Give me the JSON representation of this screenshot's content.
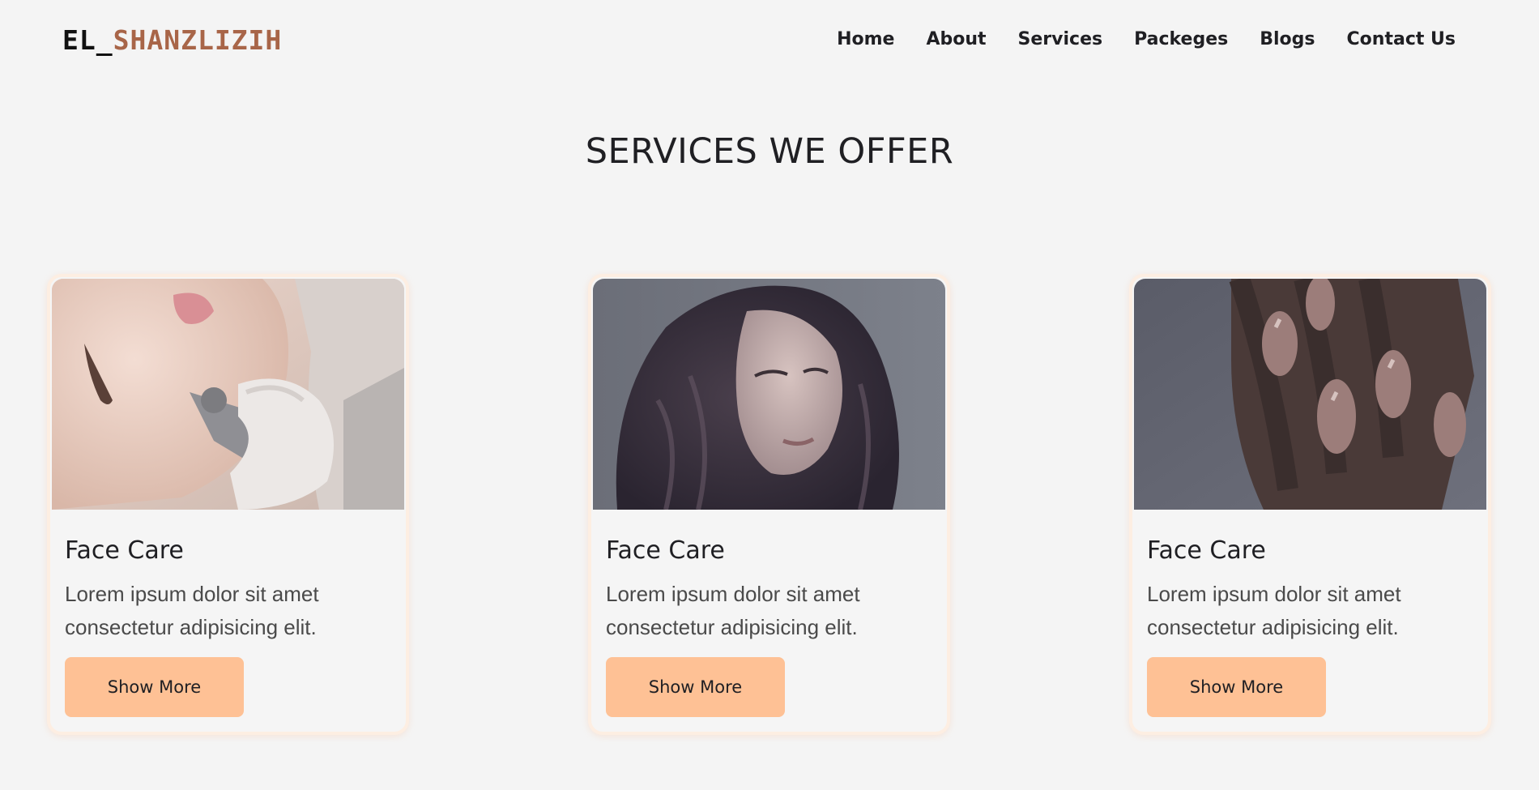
{
  "brand": {
    "logo_main": "EL_",
    "logo_accent": "SHANZLIZIH",
    "accent_color": "#a86548"
  },
  "nav": {
    "items": [
      {
        "label": "Home"
      },
      {
        "label": "About"
      },
      {
        "label": "Services"
      },
      {
        "label": "Packeges"
      },
      {
        "label": "Blogs"
      },
      {
        "label": "Contact Us"
      }
    ]
  },
  "services": {
    "title": "SERVICES WE OFFER",
    "button_color": "#fec195",
    "cards": [
      {
        "image": "face-treatment-photo",
        "title": "Face Care",
        "text": "Lorem ipsum dolor sit amet consectetur adipisicing elit.",
        "button_label": "Show More"
      },
      {
        "image": "hair-model-photo",
        "title": "Face Care",
        "text": "Lorem ipsum dolor sit amet consectetur adipisicing elit.",
        "button_label": "Show More"
      },
      {
        "image": "nails-photo",
        "title": "Face Care",
        "text": "Lorem ipsum dolor sit amet consectetur adipisicing elit.",
        "button_label": "Show More"
      }
    ]
  }
}
